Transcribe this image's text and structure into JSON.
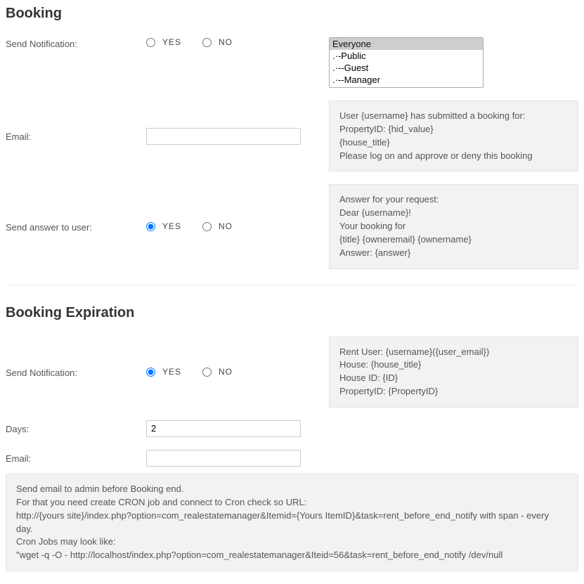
{
  "booking": {
    "heading": "Booking",
    "sendNotification": {
      "label": "Send Notification:",
      "yes": "YES",
      "no": "NO"
    },
    "recipients": {
      "options": [
        "Everyone",
        ".·-Public",
        ".·--Guest",
        ".·--Manager"
      ]
    },
    "email": {
      "label": "Email:",
      "value": ""
    },
    "template1": "User {username} has submitted a booking for:\nPropertyID: {hid_value}\n{house_title}\nPlease log on and approve or deny this booking",
    "sendAnswer": {
      "label": "Send answer to user:",
      "yes": "YES",
      "no": "NO"
    },
    "template2": "Answer for your request:\nDear {username}!\nYour booking for\n{title} {owneremail} {ownername}\nAnswer: {answer}"
  },
  "expiration": {
    "heading": "Booking Expiration",
    "sendNotification": {
      "label": "Send Notification:",
      "yes": "YES",
      "no": "NO"
    },
    "template": "Rent User: {username}({user_email})\nHouse: {house_title}\nHouse ID: {ID}\nPropertyID: {PropertyID}",
    "days": {
      "label": "Days:",
      "value": "2"
    },
    "email": {
      "label": "Email:",
      "value": ""
    },
    "cronHelp": "Send email to admin before Booking end.\nFor that you need create CRON job and connect to Cron check so URL:\nhttp://{yours site}/index.php?option=com_realestatemanager&Itemid={Yours ItemID}&task=rent_before_end_notify with span - every day.\nCron Jobs may look like:\n\"wget -q -O - http://localhost/index.php?option=com_realestatemanager&Iteid=56&task=rent_before_end_notify /dev/null"
  }
}
